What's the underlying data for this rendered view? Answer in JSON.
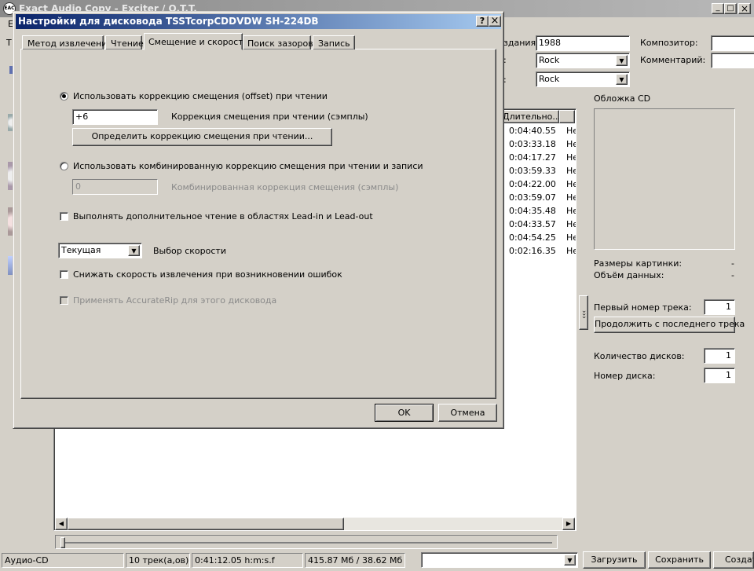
{
  "main_window": {
    "title": "Exact Audio Copy - Exciter / O.T.T.",
    "app_icon": "EAC",
    "menu_letter": "E",
    "toolbar_letter": "T",
    "controls": {
      "minimize": "_",
      "maximize": "□",
      "close": "×"
    },
    "metadata": {
      "year_label": "здания:",
      "year_value": "1988",
      "genre_label": ":",
      "genre_value": "Rock",
      "style_label": ":",
      "style_value": "Rock",
      "composer_label": "Композитор:",
      "comment_label": "Комментарий:"
    },
    "tracks": {
      "duration_header": "Длительно...",
      "rows": [
        {
          "duration": "0:04:40.55",
          "status": "Не"
        },
        {
          "duration": "0:03:33.18",
          "status": "Не"
        },
        {
          "duration": "0:04:17.27",
          "status": "Не"
        },
        {
          "duration": "0:03:59.33",
          "status": "Не"
        },
        {
          "duration": "0:04:22.00",
          "status": "Не"
        },
        {
          "duration": "0:03:59.07",
          "status": "Не"
        },
        {
          "duration": "0:04:35.48",
          "status": "Не"
        },
        {
          "duration": "0:04:33.57",
          "status": "Не"
        },
        {
          "duration": "0:04:54.25",
          "status": "Не"
        },
        {
          "duration": "0:02:16.35",
          "status": "Не"
        }
      ]
    },
    "right_panel": {
      "cover_label": "Обложка CD",
      "image_size_label": "Размеры картинки:",
      "image_size_value": "-",
      "data_size_label": "Объём данных:",
      "data_size_value": "-",
      "first_track_label": "Первый номер трека:",
      "first_track_value": "1",
      "continue_button": "Продолжить с последнего трека",
      "disc_count_label": "Количество дисков:",
      "disc_count_value": "1",
      "disc_number_label": "Номер диска:",
      "disc_number_value": "1",
      "collapse_arrows": "›››"
    },
    "status_bar": {
      "mode": "Аудио-CD",
      "tracks": "10 трек(а,ов)",
      "time": "0:41:12.05 h:m:s.f",
      "size": "415.87 Мб / 38.62 Мб",
      "load_button": "Загрузить",
      "save_button": "Сохранить",
      "create_button": "Создат"
    }
  },
  "dialog": {
    "title": "Настройки для дисковода TSSTcorpCDDVDW SH-224DB",
    "help_button": "?",
    "close_button": "×",
    "tabs": [
      {
        "label": "Метод извлечения",
        "active": false
      },
      {
        "label": "Чтение",
        "active": false
      },
      {
        "label": "Смещение и скорость",
        "active": true
      },
      {
        "label": "Поиск зазоров",
        "active": false
      },
      {
        "label": "Запись",
        "active": false
      }
    ],
    "offset_radio_label": "Использовать коррекцию смещения (offset) при чтении",
    "offset_radio_checked": true,
    "offset_value": "+6",
    "offset_value_label": "Коррекция смещения при чтении (сэмплы)",
    "detect_offset_button": "Определить коррекцию смещения при чтении...",
    "combined_radio_label": "Использовать комбинированную коррекцию смещения при чтении и записи",
    "combined_radio_checked": false,
    "combined_value": "0",
    "combined_value_label": "Комбинированная коррекция смещения (сэмплы)",
    "leadin_check_label": "Выполнять дополнительное чтение в областях Lead-in и Lead-out",
    "leadin_checked": false,
    "speed_value": "Текущая",
    "speed_label": "Выбор скорости",
    "reduce_speed_label": "Снижать скорость извлечения при возникновении ошибок",
    "reduce_speed_checked": false,
    "accuraterip_label": "Применять AccurateRip для этого дисковода",
    "accuraterip_checked": false,
    "ok_button": "OK",
    "cancel_button": "Отмена"
  }
}
